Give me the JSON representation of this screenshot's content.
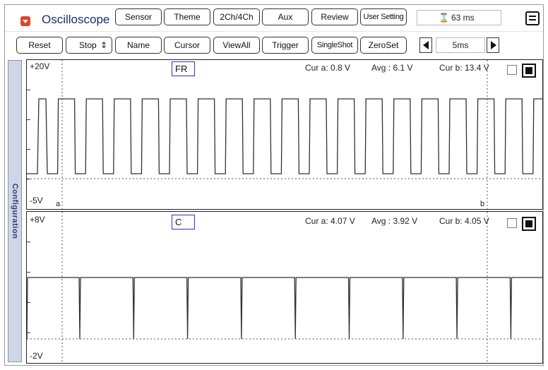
{
  "app": {
    "title": "Oscilloscope",
    "icon": "dropdown-icon",
    "accent": "#d9472b"
  },
  "toolbar1": {
    "buttons": [
      "Sensor",
      "Theme",
      "2Ch/4Ch",
      "Aux",
      "Review",
      "User Setting"
    ],
    "timer": "63 ms",
    "timer_icon": "hourglass-icon"
  },
  "toolbar2": {
    "buttons": [
      "Reset",
      "Stop",
      "Name",
      "Cursor",
      "ViewAll",
      "Trigger",
      "SingleShot",
      "ZeroSet"
    ],
    "stop_spin": "⇕",
    "timebase": "5ms"
  },
  "side_tab": "Configuration",
  "channels": [
    {
      "name": "FR",
      "scale_top": "+20V",
      "scale_bottom": "-5V",
      "cur_a": "Cur a: 0.8 V",
      "avg": "Avg  : 6.1 V",
      "cur_b": "Cur b: 13.4 V",
      "cursor_a_label": "a",
      "cursor_b_label": "b",
      "trace_color": "#333333"
    },
    {
      "name": "C",
      "scale_top": "+8V",
      "scale_bottom": "-2V",
      "cur_a": "Cur a: 4.07 V",
      "avg": "Avg  : 3.92 V",
      "cur_b": "Cur b: 4.05 V",
      "trace_color": "#333333"
    }
  ]
}
